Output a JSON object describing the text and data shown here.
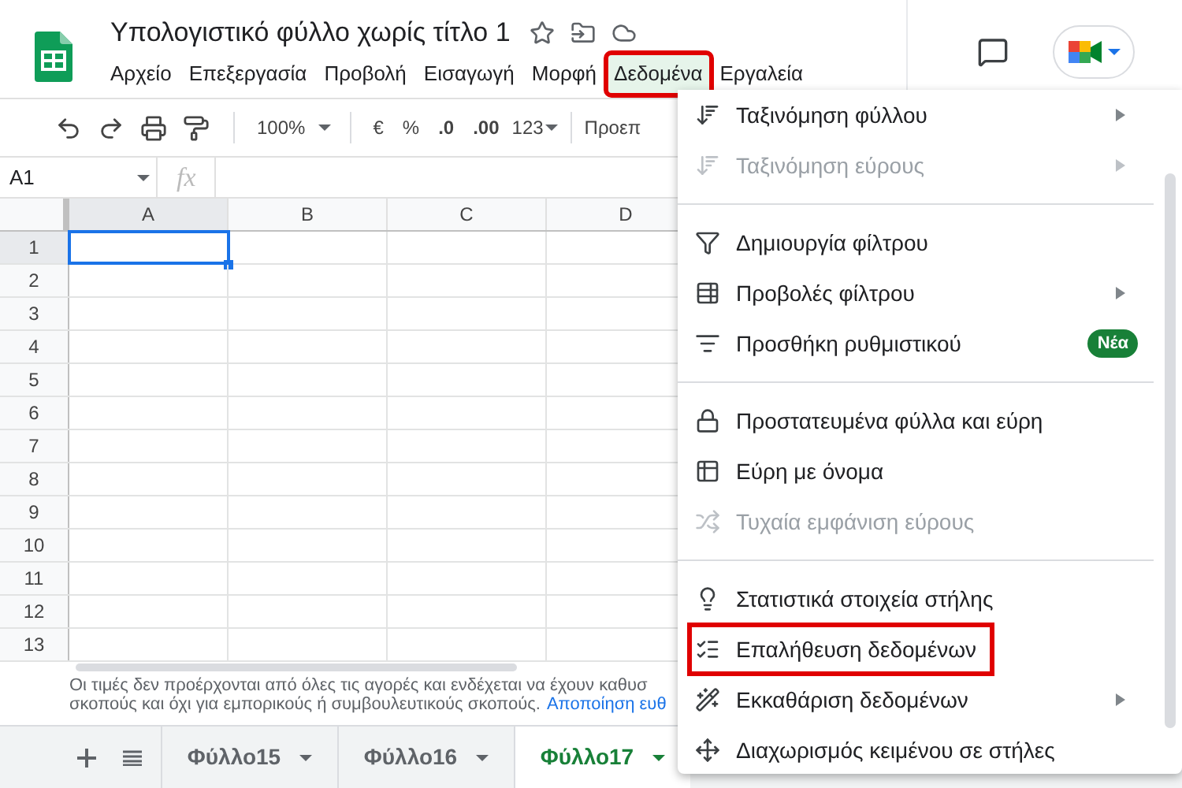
{
  "doc_title": "Υπολογιστικό φύλλο χωρίς τίτλο 1",
  "menu_bar": [
    {
      "label": "Αρχείο",
      "selected": false
    },
    {
      "label": "Επεξεργασία",
      "selected": false
    },
    {
      "label": "Προβολή",
      "selected": false
    },
    {
      "label": "Εισαγωγή",
      "selected": false
    },
    {
      "label": "Μορφή",
      "selected": false
    },
    {
      "label": "Δεδομένα",
      "selected": true,
      "annotated": true
    },
    {
      "label": "Εργαλεία",
      "selected": false
    }
  ],
  "toolbar": {
    "zoom": "100%",
    "currency": "€",
    "percent": "%",
    "decrease_decimals": ".0",
    "increase_decimals": ".00",
    "number_format": "123",
    "font": "Προεπ"
  },
  "name_box": "A1",
  "formula_label": "fx",
  "grid": {
    "columns": [
      {
        "label": "A",
        "selected": true
      },
      {
        "label": "B",
        "selected": false
      },
      {
        "label": "C",
        "selected": false
      },
      {
        "label": "D",
        "selected": false
      }
    ],
    "rows": [
      {
        "label": "1",
        "selected": true
      },
      {
        "label": "2",
        "selected": false
      },
      {
        "label": "3",
        "selected": false
      },
      {
        "label": "4",
        "selected": false
      },
      {
        "label": "5",
        "selected": false
      },
      {
        "label": "6",
        "selected": false
      },
      {
        "label": "7",
        "selected": false
      },
      {
        "label": "8",
        "selected": false
      },
      {
        "label": "9",
        "selected": false
      },
      {
        "label": "10",
        "selected": false
      },
      {
        "label": "11",
        "selected": false
      },
      {
        "label": "12",
        "selected": false
      },
      {
        "label": "13",
        "selected": false
      }
    ]
  },
  "disclaimer": {
    "lines": [
      "Οι τιμές δεν προέρχονται από όλες τις αγορές και ενδέχεται να έχουν καθυσ",
      "σκοπούς και όχι για εμπορικούς ή συμβουλευτικούς σκοπούς."
    ],
    "link": "Αποποίηση ευθ"
  },
  "sheet_tabs": [
    {
      "label": "Φύλλο15",
      "selected": false
    },
    {
      "label": "Φύλλο16",
      "selected": false
    },
    {
      "label": "Φύλλο17",
      "selected": true
    }
  ],
  "data_menu": [
    {
      "kind": "item",
      "label": "Ταξινόμηση φύλλου",
      "disabled": false,
      "submenu": true
    },
    {
      "kind": "item",
      "label": "Ταξινόμηση εύρους",
      "disabled": true,
      "submenu": true
    },
    {
      "kind": "separator"
    },
    {
      "kind": "item",
      "label": "Δημιουργία φίλτρου",
      "disabled": false,
      "submenu": false
    },
    {
      "kind": "item",
      "label": "Προβολές φίλτρου",
      "disabled": false,
      "submenu": true
    },
    {
      "kind": "item",
      "label": "Προσθήκη ρυθμιστικού",
      "disabled": false,
      "submenu": false,
      "badge": "Νέα"
    },
    {
      "kind": "separator"
    },
    {
      "kind": "item",
      "label": "Προστατευμένα φύλλα και εύρη",
      "disabled": false,
      "submenu": false
    },
    {
      "kind": "item",
      "label": "Εύρη με όνομα",
      "disabled": false,
      "submenu": false
    },
    {
      "kind": "item",
      "label": "Τυχαία εμφάνιση εύρους",
      "disabled": true,
      "submenu": false
    },
    {
      "kind": "separator"
    },
    {
      "kind": "item",
      "label": "Στατιστικά στοιχεία στήλης",
      "disabled": false,
      "submenu": false
    },
    {
      "kind": "item",
      "label": "Επαλήθευση δεδομένων",
      "disabled": false,
      "submenu": false,
      "annotated": true
    },
    {
      "kind": "item",
      "label": "Εκκαθάριση δεδομένων",
      "disabled": false,
      "submenu": true
    },
    {
      "kind": "item",
      "label": "Διαχωρισμός κειμένου σε στήλες",
      "disabled": false,
      "submenu": false
    }
  ]
}
